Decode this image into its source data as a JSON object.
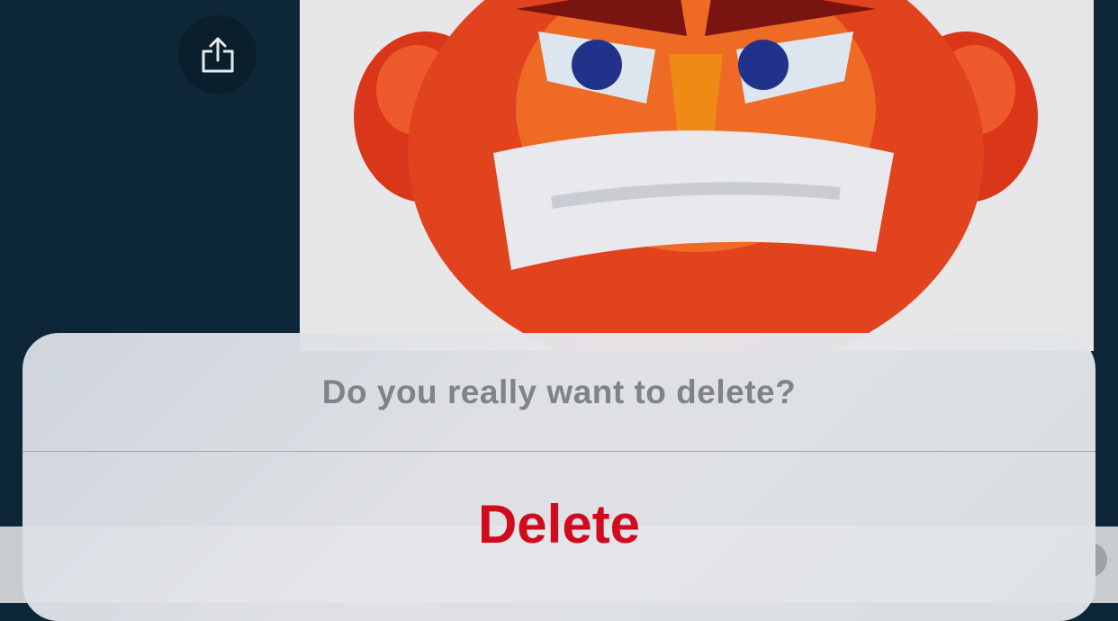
{
  "toolbar": {
    "share_icon": "share-icon"
  },
  "image": {
    "description_icon": "angry-face-image"
  },
  "action_sheet": {
    "title": "Do you really want to delete?",
    "delete_label": "Delete",
    "delete_color": "#d00b1d"
  }
}
